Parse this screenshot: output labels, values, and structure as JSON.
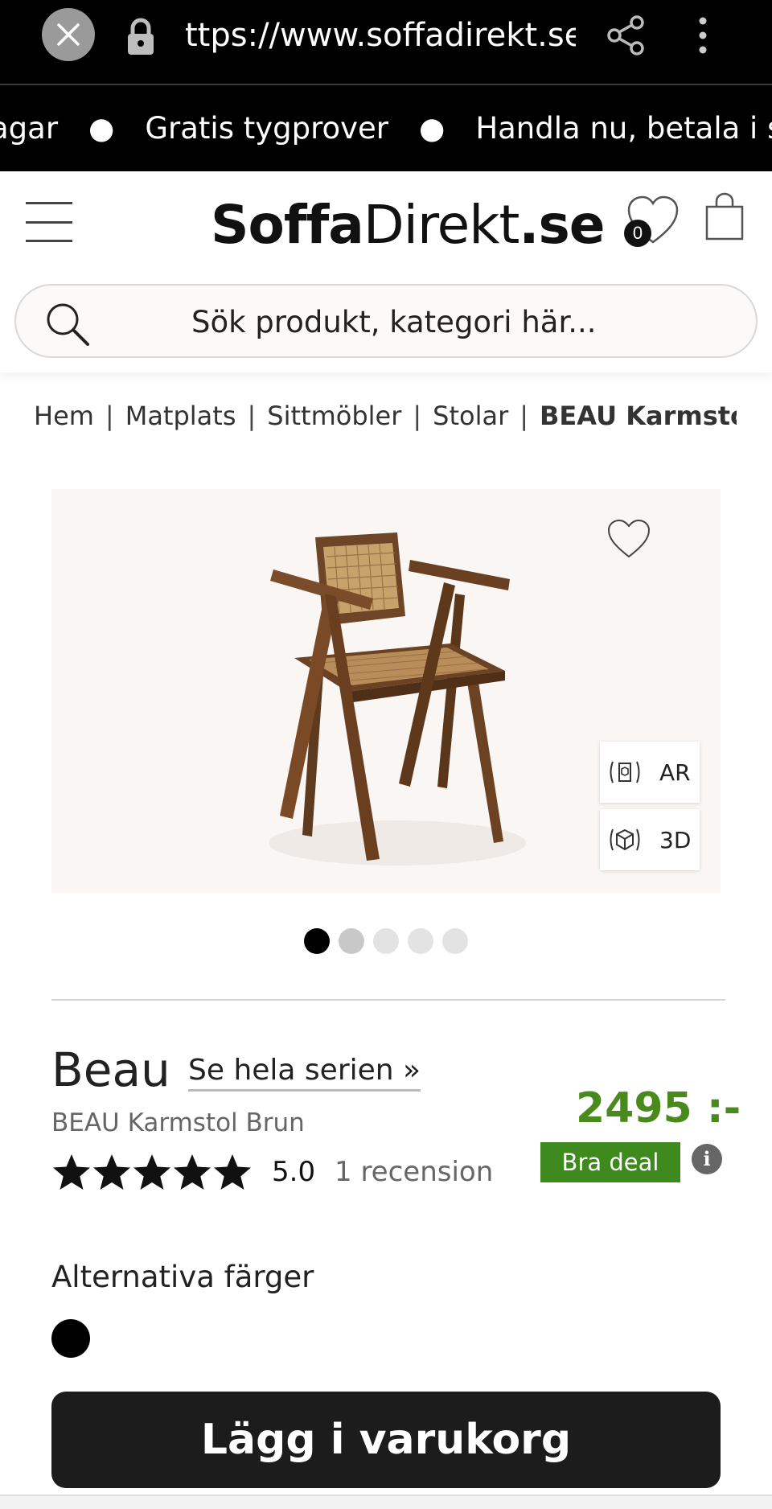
{
  "browser": {
    "url": "ttps://www.soffadirekt.se/s",
    "close_icon": "close-icon",
    "lock_icon": "lock-icon",
    "share_icon": "share-icon",
    "menu_icon": "kebab-menu-icon"
  },
  "marquee": {
    "items": [
      "agar",
      "Gratis tygprover",
      "Handla nu, betala i slut"
    ],
    "separator": "●"
  },
  "header": {
    "logo_bold": "Soffa",
    "logo_thin": "Direkt",
    "logo_suffix": ".se",
    "wishlist_count": "0",
    "search_placeholder": "Sök produkt, kategori här..."
  },
  "breadcrumb": {
    "items": [
      "Hem",
      "Matplats",
      "Sittmöbler",
      "Stolar"
    ],
    "current": "BEAU Karmstol B",
    "separator": "|"
  },
  "gallery": {
    "ar_label": "AR",
    "three_d_label": "3D",
    "slide_count": 5,
    "active_slide": 1
  },
  "product": {
    "series": "Beau",
    "series_link": "Se hela serien »",
    "name": "BEAU Karmstol Brun",
    "rating": "5.0",
    "rating_stars": 5,
    "reviews": "1 recension",
    "price": "2495 :-",
    "deal_badge": "Bra deal",
    "info_icon_text": "i",
    "alt_colors_label": "Alternativa färger",
    "alt_colors": [
      "#000000"
    ],
    "price_color": "#4a8a1c",
    "deal_color": "#3f8a1e"
  },
  "actions": {
    "add_to_cart": "Lägg i varukorg"
  }
}
